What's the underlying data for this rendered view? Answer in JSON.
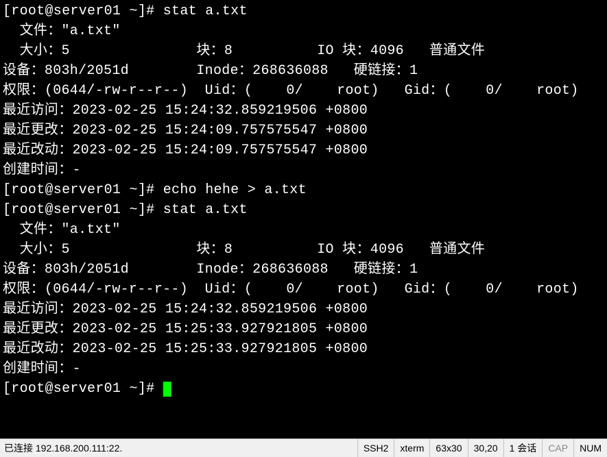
{
  "terminal": {
    "lines": [
      "[root@server01 ~]# stat a.txt",
      "  文件：\"a.txt\"",
      "  大小：5               块：8          IO 块：4096   普通文件",
      "设备：803h/2051d        Inode：268636088   硬链接：1",
      "权限：(0644/-rw-r--r--)  Uid：(    0/    root)   Gid：(    0/    root)",
      "最近访问：2023-02-25 15:24:32.859219506 +0800",
      "最近更改：2023-02-25 15:24:09.757575547 +0800",
      "最近改动：2023-02-25 15:24:09.757575547 +0800",
      "创建时间：-",
      "[root@server01 ~]# echo hehe > a.txt",
      "[root@server01 ~]# stat a.txt",
      "  文件：\"a.txt\"",
      "  大小：5               块：8          IO 块：4096   普通文件",
      "设备：803h/2051d        Inode：268636088   硬链接：1",
      "权限：(0644/-rw-r--r--)  Uid：(    0/    root)   Gid：(    0/    root)",
      "最近访问：2023-02-25 15:24:32.859219506 +0800",
      "最近更改：2023-02-25 15:25:33.927921805 +0800",
      "最近改动：2023-02-25 15:25:33.927921805 +0800",
      "创建时间：-"
    ],
    "prompt": "[root@server01 ~]# "
  },
  "statusbar": {
    "connection": "已连接 192.168.200.111:22.",
    "protocol": "SSH2",
    "termtype": "xterm",
    "size": "63x30",
    "cursor_pos": "30,20",
    "sessions": "1 会话",
    "cap": "CAP",
    "num": "NUM"
  }
}
